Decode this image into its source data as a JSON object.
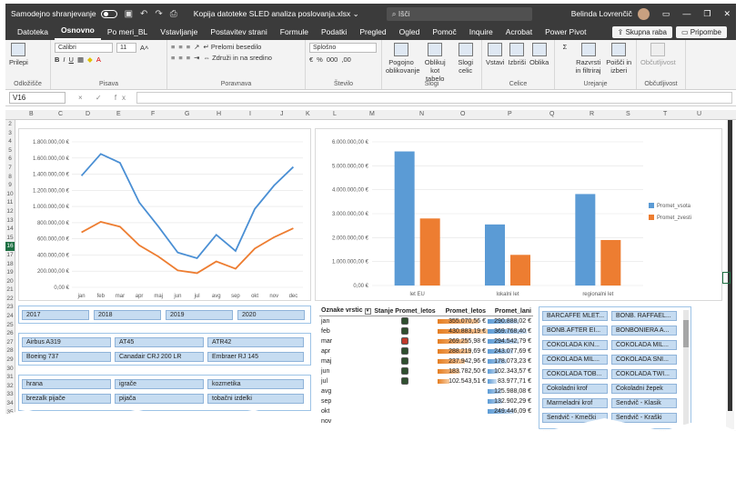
{
  "titlebar": {
    "autosave_label": "Samodejno shranjevanje",
    "filename": "Kopija datoteke SLED analiza poslovanja.xlsx",
    "filename_caret": "⌄",
    "search_placeholder": "Išči",
    "user": "Belinda Lovrenčič"
  },
  "tabs": [
    "Datoteka",
    "Osnovno",
    "Po meri_BL",
    "Vstavljanje",
    "Postavitev strani",
    "Formule",
    "Podatki",
    "Pregled",
    "Ogled",
    "Pomoč",
    "Inquire",
    "Acrobat",
    "Power Pivot"
  ],
  "share_label": "Skupna raba",
  "comments_label": "Pripombe",
  "ribbon": {
    "paste_label": "Prilepi",
    "clipboard_label": "Odložišče",
    "font_name": "Calibri",
    "font_size": "11",
    "font_label": "Pisava",
    "wrap_label": "Prelomi besedilo",
    "merge_label": "Združi in na sredino",
    "alignment_label": "Poravnava",
    "number_format": "Splošno",
    "number_label": "Število",
    "cond_format_label": "Pogojno oblikovanje",
    "table_format_label": "Oblikuj kot tabelo",
    "cell_styles_label": "Slogi celic",
    "styles_label": "Slogi",
    "insert_label": "Vstavi",
    "delete_label": "Izbriši",
    "format_label": "Oblika",
    "cells_label": "Celice",
    "sort_label": "Razvrsti in filtriraj",
    "find_label": "Poišči in izberi",
    "editing_label": "Urejanje",
    "sensitivity_label": "Občutljivost"
  },
  "formula_bar": {
    "name_box": "V16",
    "fx": "×  ✓  fx",
    "formula": ""
  },
  "columns": [
    "B",
    "C",
    "D",
    "E",
    "F",
    "G",
    "H",
    "I",
    "J",
    "K",
    "L",
    "M",
    "N",
    "O",
    "P",
    "Q",
    "R",
    "S",
    "T",
    "U"
  ],
  "rows": [
    "2",
    "3",
    "4",
    "5",
    "6",
    "7",
    "8",
    "9",
    "10",
    "11",
    "12",
    "13",
    "14",
    "15",
    "16",
    "17",
    "18",
    "19",
    "20",
    "21",
    "22",
    "23",
    "24",
    "25",
    "26",
    "27",
    "28",
    "29",
    "30",
    "31",
    "32",
    "33",
    "34",
    "35",
    "36"
  ],
  "selected_row": "16",
  "line_chart": {
    "y_ticks": [
      "1.800.000,00 €",
      "1.600.000,00 €",
      "1.400.000,00 €",
      "1.200.000,00 €",
      "1.000.000,00 €",
      "800.000,00 €",
      "600.000,00 €",
      "400.000,00 €",
      "200.000,00 €",
      "0,00 €"
    ],
    "colors": {
      "s1": "#4a8fd4",
      "s2": "#ed7d31"
    }
  },
  "bar_chart": {
    "y_ticks": [
      "6.000.000,00 €",
      "5.000.000,00 €",
      "4.000.000,00 €",
      "3.000.000,00 €",
      "2.000.000,00 €",
      "1.000.000,00 €",
      "0,00 €"
    ],
    "colors": {
      "s1": "#5b9bd5",
      "s2": "#ed7d31"
    }
  },
  "chart_data": [
    {
      "type": "line",
      "categories": [
        "jan",
        "feb",
        "mar",
        "apr",
        "maj",
        "jun",
        "jul",
        "avg",
        "sep",
        "okt",
        "nov",
        "dec"
      ],
      "series": [
        {
          "values": [
            1380000,
            1650000,
            1540000,
            1050000,
            750000,
            430000,
            360000,
            650000,
            450000,
            970000,
            1260000,
            1490000
          ]
        },
        {
          "values": [
            680000,
            810000,
            750000,
            520000,
            380000,
            210000,
            175000,
            320000,
            230000,
            480000,
            620000,
            730000
          ]
        }
      ],
      "ylim": [
        0,
        1800000
      ]
    },
    {
      "type": "bar",
      "categories": [
        "let EU",
        "lokalni let",
        "regionalni let"
      ],
      "series": [
        {
          "name": "Promet_vsota",
          "values": [
            5600000,
            2550000,
            3820000
          ]
        },
        {
          "name": "Promet_zvesti",
          "values": [
            2800000,
            1280000,
            1900000
          ]
        }
      ],
      "ylim": [
        0,
        6000000
      ],
      "legend": "right"
    }
  ],
  "slicers": {
    "years": [
      "2017",
      "2018",
      "2019",
      "2020"
    ],
    "aircraft": [
      "Airbus A319",
      "AT45",
      "ATR42",
      "Boeing 737",
      "Canadair CRJ 200 LR",
      "Embraer RJ 145"
    ],
    "categories": [
      "hrana",
      "igrače",
      "kozmetika",
      "brezalk pijače",
      "pijača",
      "tobačni izdelki"
    ],
    "products": [
      "BARCAFFE MLET...",
      "BONB. RAFFAEL...",
      "BONB.AFTER EI...",
      "BONBONIERA A...",
      "ČOKOLADA KIN...",
      "ČOKOLADA MIL...",
      "ČOKOLADA MIL...",
      "ČOKOLADA SNI...",
      "ČOKOLADA TOB...",
      "ČOKOLADA TWI...",
      "Čokoladni krof",
      "Čokoladni žepek",
      "Marmeladni krof",
      "Sendvič - Klasik",
      "Sendvič - Kmečki",
      "Sendvič - Kraški"
    ]
  },
  "pivot": {
    "headers": [
      "Oznake vrstic",
      "Stanje Promet_letos",
      "Promet_letos",
      "Promet_lani"
    ],
    "rows": [
      {
        "label": "jan",
        "kpi": "green",
        "letos": "355.070,56 €",
        "lani": "290.888,02 €",
        "letos_frac": 0.82,
        "lani_frac": 0.67
      },
      {
        "label": "feb",
        "kpi": "green",
        "letos": "430.883,19 €",
        "lani": "369.768,40 €",
        "letos_frac": 1.0,
        "lani_frac": 0.86
      },
      {
        "label": "mar",
        "kpi": "red",
        "letos": "269.255,98 €",
        "lani": "294.542,79 €",
        "letos_frac": 0.62,
        "lani_frac": 0.68
      },
      {
        "label": "apr",
        "kpi": "green",
        "letos": "288.219,69 €",
        "lani": "243.077,69 €",
        "letos_frac": 0.67,
        "lani_frac": 0.56
      },
      {
        "label": "maj",
        "kpi": "green",
        "letos": "237.942,96 €",
        "lani": "178.073,23 €",
        "letos_frac": 0.55,
        "lani_frac": 0.41
      },
      {
        "label": "jun",
        "kpi": "green",
        "letos": "183.782,50 €",
        "lani": "102.343,57 €",
        "letos_frac": 0.43,
        "lani_frac": 0.24
      },
      {
        "label": "jul",
        "kpi": "green",
        "letos": "102.543,51 €",
        "lani": "83.977,71 €",
        "letos_frac": 0.24,
        "lani_frac": 0.19
      },
      {
        "label": "avg",
        "kpi": "",
        "letos": "",
        "lani": "125.988,08 €",
        "letos_frac": 0,
        "lani_frac": 0.29
      },
      {
        "label": "sep",
        "kpi": "",
        "letos": "",
        "lani": "132.902,29 €",
        "letos_frac": 0,
        "lani_frac": 0.31
      },
      {
        "label": "okt",
        "kpi": "",
        "letos": "",
        "lani": "249.446,09 €",
        "letos_frac": 0,
        "lani_frac": 0.58
      },
      {
        "label": "nov",
        "kpi": "",
        "letos": "",
        "lani": "",
        "letos_frac": 0,
        "lani_frac": 0
      }
    ]
  }
}
